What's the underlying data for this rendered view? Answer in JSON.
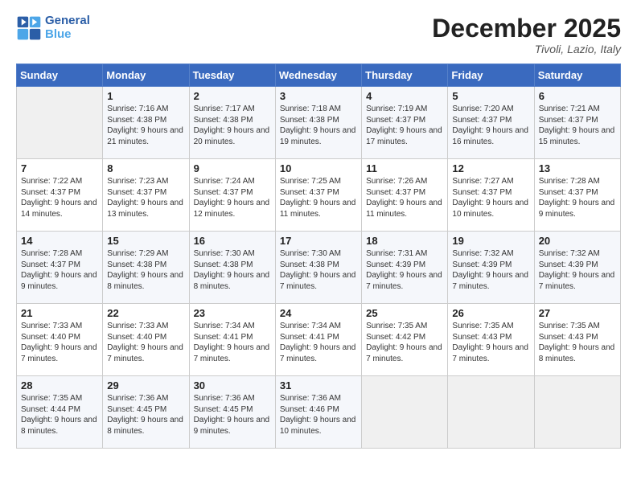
{
  "header": {
    "logo_line1": "General",
    "logo_line2": "Blue",
    "month": "December 2025",
    "location": "Tivoli, Lazio, Italy"
  },
  "weekdays": [
    "Sunday",
    "Monday",
    "Tuesday",
    "Wednesday",
    "Thursday",
    "Friday",
    "Saturday"
  ],
  "weeks": [
    [
      {
        "num": "",
        "empty": true
      },
      {
        "num": "1",
        "rise": "7:16 AM",
        "set": "4:38 PM",
        "daylight": "9 hours and 21 minutes."
      },
      {
        "num": "2",
        "rise": "7:17 AM",
        "set": "4:38 PM",
        "daylight": "9 hours and 20 minutes."
      },
      {
        "num": "3",
        "rise": "7:18 AM",
        "set": "4:38 PM",
        "daylight": "9 hours and 19 minutes."
      },
      {
        "num": "4",
        "rise": "7:19 AM",
        "set": "4:37 PM",
        "daylight": "9 hours and 17 minutes."
      },
      {
        "num": "5",
        "rise": "7:20 AM",
        "set": "4:37 PM",
        "daylight": "9 hours and 16 minutes."
      },
      {
        "num": "6",
        "rise": "7:21 AM",
        "set": "4:37 PM",
        "daylight": "9 hours and 15 minutes."
      }
    ],
    [
      {
        "num": "7",
        "rise": "7:22 AM",
        "set": "4:37 PM",
        "daylight": "9 hours and 14 minutes."
      },
      {
        "num": "8",
        "rise": "7:23 AM",
        "set": "4:37 PM",
        "daylight": "9 hours and 13 minutes."
      },
      {
        "num": "9",
        "rise": "7:24 AM",
        "set": "4:37 PM",
        "daylight": "9 hours and 12 minutes."
      },
      {
        "num": "10",
        "rise": "7:25 AM",
        "set": "4:37 PM",
        "daylight": "9 hours and 11 minutes."
      },
      {
        "num": "11",
        "rise": "7:26 AM",
        "set": "4:37 PM",
        "daylight": "9 hours and 11 minutes."
      },
      {
        "num": "12",
        "rise": "7:27 AM",
        "set": "4:37 PM",
        "daylight": "9 hours and 10 minutes."
      },
      {
        "num": "13",
        "rise": "7:28 AM",
        "set": "4:37 PM",
        "daylight": "9 hours and 9 minutes."
      }
    ],
    [
      {
        "num": "14",
        "rise": "7:28 AM",
        "set": "4:37 PM",
        "daylight": "9 hours and 9 minutes."
      },
      {
        "num": "15",
        "rise": "7:29 AM",
        "set": "4:38 PM",
        "daylight": "9 hours and 8 minutes."
      },
      {
        "num": "16",
        "rise": "7:30 AM",
        "set": "4:38 PM",
        "daylight": "9 hours and 8 minutes."
      },
      {
        "num": "17",
        "rise": "7:30 AM",
        "set": "4:38 PM",
        "daylight": "9 hours and 7 minutes."
      },
      {
        "num": "18",
        "rise": "7:31 AM",
        "set": "4:39 PM",
        "daylight": "9 hours and 7 minutes."
      },
      {
        "num": "19",
        "rise": "7:32 AM",
        "set": "4:39 PM",
        "daylight": "9 hours and 7 minutes."
      },
      {
        "num": "20",
        "rise": "7:32 AM",
        "set": "4:39 PM",
        "daylight": "9 hours and 7 minutes."
      }
    ],
    [
      {
        "num": "21",
        "rise": "7:33 AM",
        "set": "4:40 PM",
        "daylight": "9 hours and 7 minutes."
      },
      {
        "num": "22",
        "rise": "7:33 AM",
        "set": "4:40 PM",
        "daylight": "9 hours and 7 minutes."
      },
      {
        "num": "23",
        "rise": "7:34 AM",
        "set": "4:41 PM",
        "daylight": "9 hours and 7 minutes."
      },
      {
        "num": "24",
        "rise": "7:34 AM",
        "set": "4:41 PM",
        "daylight": "9 hours and 7 minutes."
      },
      {
        "num": "25",
        "rise": "7:35 AM",
        "set": "4:42 PM",
        "daylight": "9 hours and 7 minutes."
      },
      {
        "num": "26",
        "rise": "7:35 AM",
        "set": "4:43 PM",
        "daylight": "9 hours and 7 minutes."
      },
      {
        "num": "27",
        "rise": "7:35 AM",
        "set": "4:43 PM",
        "daylight": "9 hours and 8 minutes."
      }
    ],
    [
      {
        "num": "28",
        "rise": "7:35 AM",
        "set": "4:44 PM",
        "daylight": "9 hours and 8 minutes."
      },
      {
        "num": "29",
        "rise": "7:36 AM",
        "set": "4:45 PM",
        "daylight": "9 hours and 8 minutes."
      },
      {
        "num": "30",
        "rise": "7:36 AM",
        "set": "4:45 PM",
        "daylight": "9 hours and 9 minutes."
      },
      {
        "num": "31",
        "rise": "7:36 AM",
        "set": "4:46 PM",
        "daylight": "9 hours and 10 minutes."
      },
      {
        "num": "",
        "empty": true
      },
      {
        "num": "",
        "empty": true
      },
      {
        "num": "",
        "empty": true
      }
    ]
  ]
}
